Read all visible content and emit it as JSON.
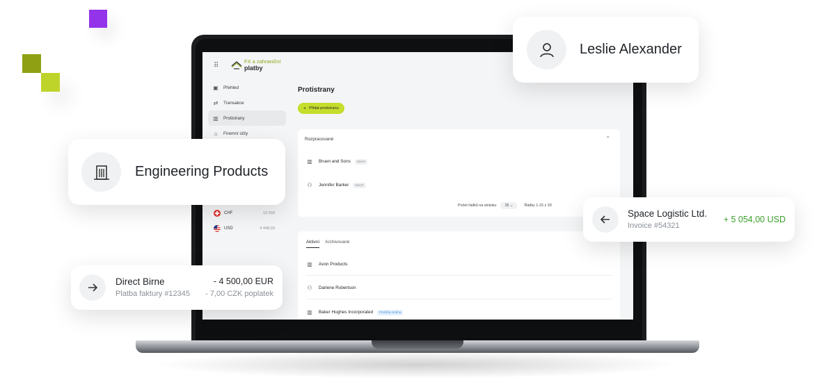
{
  "app": {
    "logo_top": "FX a zahraniční",
    "logo_bottom": "platby",
    "brand_color": "#c5dd2c"
  },
  "sidebar": {
    "items": [
      {
        "label": "Přehled",
        "icon": "dashboard-icon"
      },
      {
        "label": "Transakce",
        "icon": "transfer-icon"
      },
      {
        "label": "Protistrany",
        "icon": "building-icon"
      },
      {
        "label": "Firemní účty",
        "icon": "bank-icon"
      }
    ],
    "accounts": [
      {
        "currency": "CHF",
        "amount": "12 033"
      },
      {
        "currency": "USD",
        "amount": "4 448,93"
      }
    ]
  },
  "main": {
    "title": "Protistrany",
    "add_button": "Přidat protistranu",
    "drafts": {
      "heading": "Rozpracované",
      "rows": [
        {
          "name": "Bruen and Sons",
          "tag": "Návrh",
          "icon": "building-icon"
        },
        {
          "name": "Jennifer Barker",
          "tag": "Návrh",
          "icon": "person-icon"
        }
      ],
      "pager_label": "Počet řádků na stránku",
      "pager_value": "15",
      "pager_range": "Řádky 1-15 z 33"
    },
    "list": {
      "tabs": [
        "Aktivní",
        "Archivované"
      ],
      "rows": [
        {
          "name": "Avon Products",
          "tag": "",
          "icon": "building-icon"
        },
        {
          "name": "Darlene Robertson",
          "tag": "",
          "icon": "person-icon"
        },
        {
          "name": "Baker Hughes Incorporated",
          "tag": "Probíhá změna",
          "icon": "building-icon"
        }
      ]
    }
  },
  "floating": {
    "leslie": {
      "name": "Leslie Alexander"
    },
    "engineering": {
      "name": "Engineering Products"
    },
    "space": {
      "title": "Space Logistic Ltd.",
      "subtitle": "Invoice #54321",
      "amount": "+ 5 054,00 USD",
      "amount_color": "#3aa02a"
    },
    "direct": {
      "title": "Direct Birne",
      "subtitle": "Platba faktury #12345",
      "amount": "- 4 500,00 EUR",
      "fee": "- 7,00 CZK poplatek"
    }
  }
}
